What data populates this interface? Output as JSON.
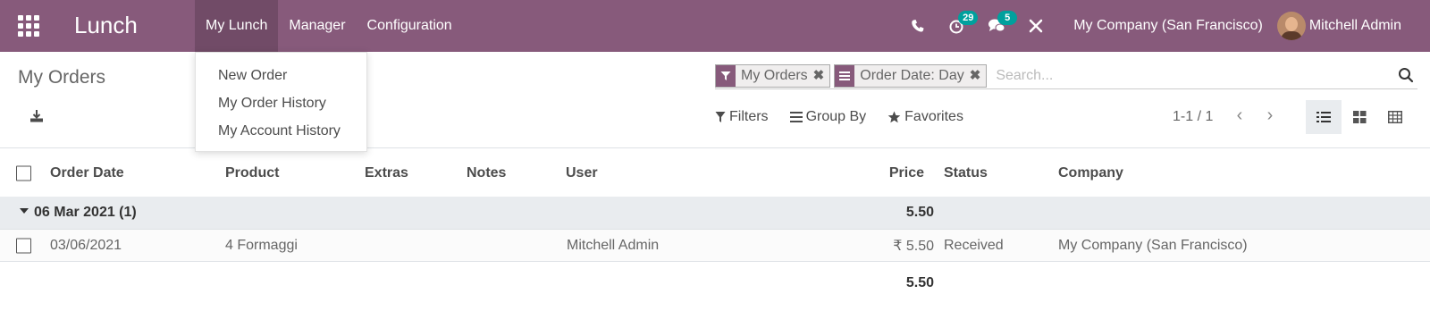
{
  "navbar": {
    "app_name": "Lunch",
    "menu": [
      "My Lunch",
      "Manager",
      "Configuration"
    ],
    "activity_count": "29",
    "message_count": "5",
    "company": "My Company (San Francisco)",
    "user": "Mitchell Admin"
  },
  "dropdown": {
    "items": [
      "New Order",
      "My Order History",
      "My Account History"
    ]
  },
  "control_panel": {
    "title": "My Orders",
    "facets": [
      "My Orders",
      "Order Date: Day"
    ],
    "search_placeholder": "Search...",
    "filters_label": "Filters",
    "groupby_label": "Group By",
    "favorites_label": "Favorites",
    "pager": "1-1 / 1"
  },
  "table": {
    "headers": [
      "Order Date",
      "Product",
      "Extras",
      "Notes",
      "User",
      "Price",
      "Status",
      "Company"
    ],
    "group": {
      "label": "06 Mar 2021 (1)",
      "total": "5.50"
    },
    "rows": [
      {
        "date": "03/06/2021",
        "product": "4 Formaggi",
        "extras": "",
        "notes": "",
        "user": "Mitchell Admin",
        "price": "₹ 5.50",
        "status": "Received",
        "company": "My Company (San Francisco)"
      }
    ],
    "footer_total": "5.50"
  },
  "colors": {
    "brand": "#875a7b",
    "brand_active": "#714b67",
    "badge": "#00a09d"
  }
}
